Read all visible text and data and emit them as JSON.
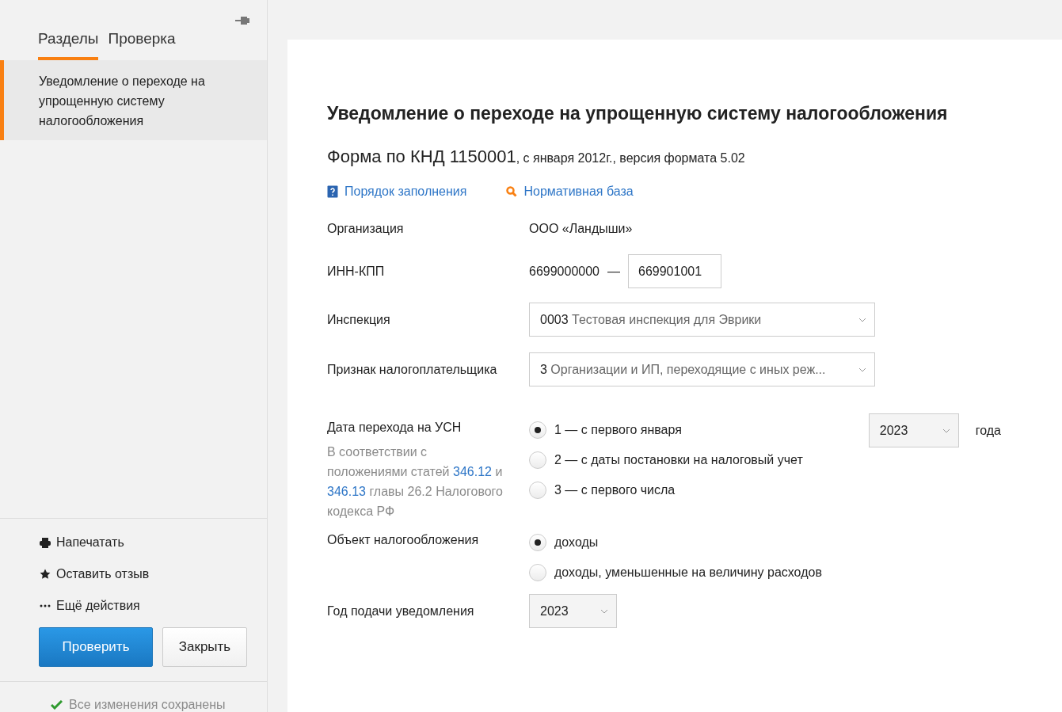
{
  "sidebar": {
    "tabs": [
      {
        "label": "Разделы",
        "selected": true
      },
      {
        "label": "Проверка",
        "selected": false
      }
    ],
    "sections": [
      {
        "label": "Уведомление о переходе на упрощенную систему налогообложения",
        "selected": true
      }
    ],
    "actions": [
      {
        "kind": "print",
        "label": "Напечатать"
      },
      {
        "kind": "star",
        "label": "Оставить отзыв"
      },
      {
        "kind": "more",
        "label": "Ещё действия"
      }
    ],
    "primary_button": "Проверить",
    "secondary_button": "Закрыть",
    "status": "Все изменения сохранены"
  },
  "form": {
    "title": "Уведомление о переходе на упрощенную систему налогообложения",
    "subtitle": "Форма по КНД 1150001",
    "subtitle_note": ", с января 2012г., версия формата 5.02",
    "links": [
      {
        "kind": "help",
        "label": "Порядок заполнения"
      },
      {
        "kind": "search",
        "label": "Нормативная база"
      }
    ],
    "fields": [
      {
        "kind": "text",
        "label": "Организация",
        "value": "ООО «Ландыши»"
      },
      {
        "kind": "inn",
        "label": "ИНН-КПП",
        "inn": "6699000000",
        "separator": "—",
        "kpp": "669901001"
      },
      {
        "kind": "select",
        "label": "Инспекция",
        "code": "0003",
        "value": "Тестовая инспекция для Эврики"
      },
      {
        "kind": "select",
        "label": "Признак налогоплательщика",
        "code": "3",
        "value": "Организации и ИП, переходящие с иных реж..."
      },
      {
        "kind": "radio",
        "label": "Дата перехода на УСН",
        "note": [
          {
            "kind": "text",
            "text": "В соответствии с положениями статей "
          },
          {
            "kind": "link",
            "text": "346.12"
          },
          {
            "kind": "text",
            "text": " и "
          },
          {
            "kind": "link",
            "text": "346.13"
          },
          {
            "kind": "text",
            "text": " главы 26.2 Налогового кодекса РФ"
          }
        ],
        "options": [
          {
            "label": "1 — с первого января",
            "selected": true
          },
          {
            "label": "2 — с даты постановки на налоговый учет",
            "selected": false
          },
          {
            "label": "3 — с первого числа",
            "selected": false
          }
        ],
        "year": "2023",
        "year_suffix": "года"
      },
      {
        "kind": "radio",
        "label": "Объект налогообложения",
        "options": [
          {
            "label": "доходы",
            "selected": true
          },
          {
            "label": "доходы, уменьшенные на величину расходов",
            "selected": false
          }
        ]
      },
      {
        "kind": "small-select",
        "label": "Год подачи уведомления",
        "value": "2023"
      }
    ]
  }
}
